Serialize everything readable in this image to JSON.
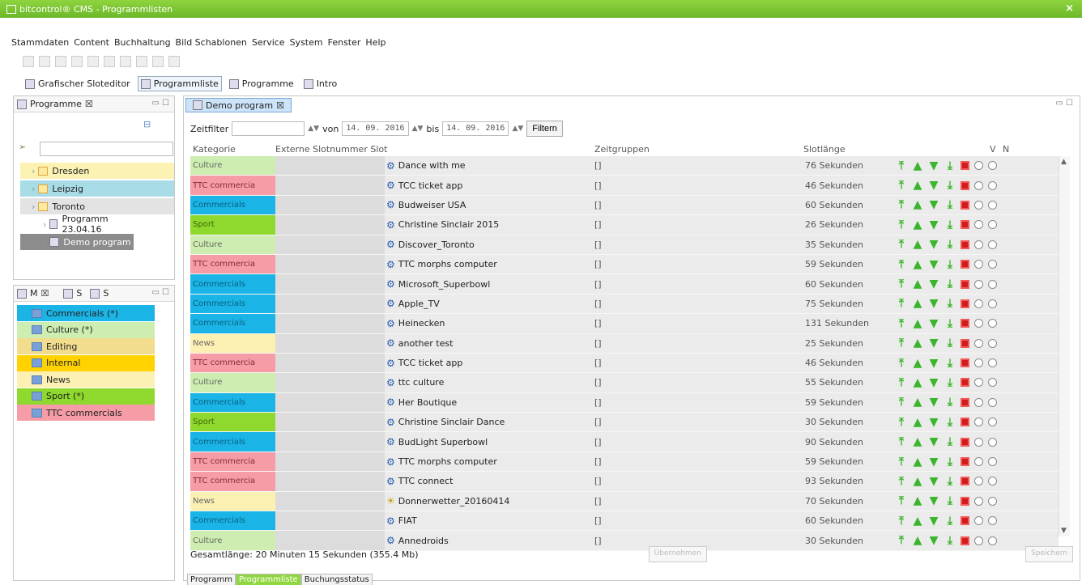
{
  "window": {
    "title": "bitcontrol® CMS - Programmlisten",
    "close": "×"
  },
  "menu": [
    "Stammdaten",
    "Content",
    "Buchhaltung",
    "Bild Schablonen",
    "Service",
    "System",
    "Fenster",
    "Help"
  ],
  "perspectives": [
    {
      "label": "Grafischer Sloteditor",
      "active": false
    },
    {
      "label": "Programmliste",
      "active": true
    },
    {
      "label": "Programme",
      "active": false
    },
    {
      "label": "Intro",
      "active": false
    }
  ],
  "left_top": {
    "tab": "Programme",
    "tree": [
      {
        "label": "Dresden",
        "color": "#fbf2b4"
      },
      {
        "label": "Leipzig",
        "color": "#a8dce6"
      },
      {
        "label": "Toronto",
        "color": "#e3e3e3"
      },
      {
        "label": "Programm 23.04.16",
        "color": ""
      },
      {
        "label": "Demo program",
        "color": "#8c8c8c"
      }
    ]
  },
  "left_bottom": {
    "tabs": [
      "M",
      "S",
      "S"
    ],
    "categories": [
      {
        "label": "Commercials (*)",
        "color": "#1ab4e6"
      },
      {
        "label": "Culture (*)",
        "color": "#cdeeb0"
      },
      {
        "label": "Editing",
        "color": "#f2dc8e"
      },
      {
        "label": "Internal",
        "color": "#ffd200"
      },
      {
        "label": "News",
        "color": "#fdf0b3"
      },
      {
        "label": "Sport (*)",
        "color": "#8fd82d"
      },
      {
        "label": "TTC commercials",
        "color": "#f59ca7"
      }
    ]
  },
  "editor": {
    "tab": "Demo program",
    "filter": {
      "zeitfilter_label": "Zeitfilter",
      "von_label": "von",
      "von_value": "14. 09. 2016",
      "bis_label": "bis",
      "bis_value": "14. 09. 2016",
      "button": "Filtern"
    },
    "headers": {
      "kategorie": "Kategorie",
      "extern": "Externe Slotnummer Slot",
      "zeit": "Zeitgruppen",
      "len": "Slotlänge",
      "v": "V",
      "n": "N"
    },
    "rows": [
      {
        "kat": "Culture",
        "color": "#cdeeb0",
        "slot": "Dance with me",
        "zeit": "[]",
        "len": "76 Sekunden"
      },
      {
        "kat": "TTC commercia",
        "color": "#f59ca7",
        "slot": "TCC ticket app",
        "zeit": "[]",
        "len": "46 Sekunden"
      },
      {
        "kat": "Commercials",
        "color": "#1ab4e6",
        "slot": "Budweiser USA",
        "zeit": "[]",
        "len": "60 Sekunden"
      },
      {
        "kat": "Sport",
        "color": "#8fd82d",
        "slot": "Christine Sinclair 2015",
        "zeit": "[]",
        "len": "26 Sekunden"
      },
      {
        "kat": "Culture",
        "color": "#cdeeb0",
        "slot": "Discover_Toronto",
        "zeit": "[]",
        "len": "35 Sekunden"
      },
      {
        "kat": "TTC commercia",
        "color": "#f59ca7",
        "slot": "TTC morphs computer",
        "zeit": "[]",
        "len": "59 Sekunden"
      },
      {
        "kat": "Commercials",
        "color": "#1ab4e6",
        "slot": "Microsoft_Superbowl",
        "zeit": "[]",
        "len": "60 Sekunden"
      },
      {
        "kat": "Commercials",
        "color": "#1ab4e6",
        "slot": "Apple_TV",
        "zeit": "[]",
        "len": "75 Sekunden"
      },
      {
        "kat": "Commercials",
        "color": "#1ab4e6",
        "slot": "Heinecken",
        "zeit": "[]",
        "len": "131 Sekunden"
      },
      {
        "kat": "News",
        "color": "#fdf0b3",
        "slot": "another test",
        "zeit": "[]",
        "len": "25 Sekunden"
      },
      {
        "kat": "TTC commercia",
        "color": "#f59ca7",
        "slot": "TCC ticket app",
        "zeit": "[]",
        "len": "46 Sekunden"
      },
      {
        "kat": "Culture",
        "color": "#cdeeb0",
        "slot": "ttc culture",
        "zeit": "[]",
        "len": "55 Sekunden"
      },
      {
        "kat": "Commercials",
        "color": "#1ab4e6",
        "slot": "Her Boutique",
        "zeit": "[]",
        "len": "59 Sekunden"
      },
      {
        "kat": "Sport",
        "color": "#8fd82d",
        "slot": "Christine Sinclair Dance",
        "zeit": "[]",
        "len": "30 Sekunden"
      },
      {
        "kat": "Commercials",
        "color": "#1ab4e6",
        "slot": "BudLight Superbowl",
        "zeit": "[]",
        "len": "90 Sekunden"
      },
      {
        "kat": "TTC commercia",
        "color": "#f59ca7",
        "slot": "TTC morphs computer",
        "zeit": "[]",
        "len": "59 Sekunden"
      },
      {
        "kat": "TTC commercia",
        "color": "#f59ca7",
        "slot": "TTC connect",
        "zeit": "[]",
        "len": "93 Sekunden"
      },
      {
        "kat": "News",
        "color": "#fdf0b3",
        "slot": "Donnerwetter_20160414",
        "zeit": "[]",
        "len": "70 Sekunden",
        "icon": "sun"
      },
      {
        "kat": "Commercials",
        "color": "#1ab4e6",
        "slot": "FIAT",
        "zeit": "[]",
        "len": "60 Sekunden"
      },
      {
        "kat": "Culture",
        "color": "#cdeeb0",
        "slot": "Annedroids",
        "zeit": "[]",
        "len": "30 Sekunden"
      }
    ],
    "summary": "Gesamtlänge: 20 Minuten 15 Sekunden  (355.4 Mb)",
    "buttons": [
      "Übernehmen",
      "Speichern"
    ]
  },
  "bottom_tabs": [
    {
      "label": "Programm",
      "active": false
    },
    {
      "label": "Programmliste",
      "active": true
    },
    {
      "label": "Buchungsstatus",
      "active": false
    }
  ],
  "colors": {
    "title_green": "#7dc634",
    "action_green": "#3bb52b",
    "delete_red": "#d21b1b"
  }
}
